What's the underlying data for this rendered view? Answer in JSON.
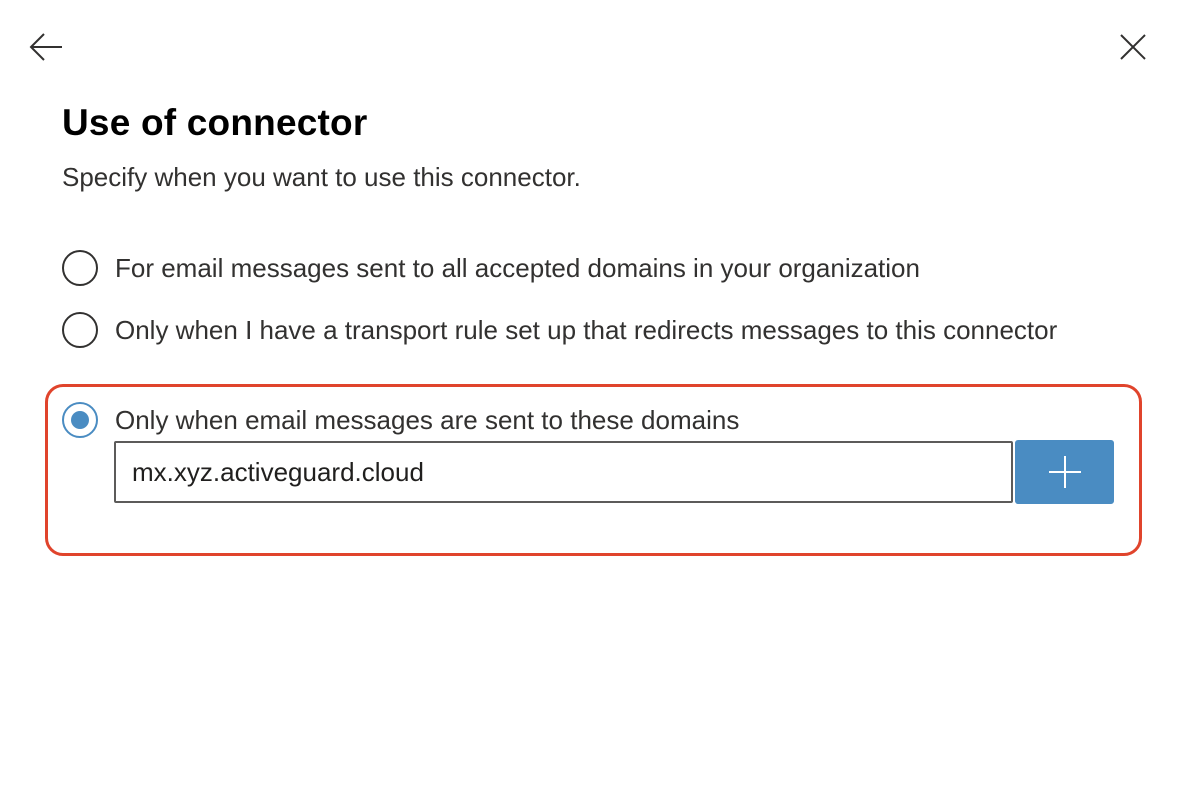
{
  "header": {
    "back_icon": "arrow-left-icon",
    "close_icon": "close-icon"
  },
  "panel": {
    "title": "Use of connector",
    "subtitle": "Specify when you want to use this connector."
  },
  "options": [
    {
      "label": "For email messages sent to all accepted domains in your organization",
      "selected": false
    },
    {
      "label": "Only when I have a transport rule set up that redirects messages to this connector",
      "selected": false
    },
    {
      "label": "Only when email messages are sent to these domains",
      "selected": true
    }
  ],
  "domain_input": {
    "value": "mx.xyz.activeguard.cloud"
  },
  "add_button": {
    "icon": "plus-icon"
  },
  "colors": {
    "accent": "#4a8cc2",
    "highlight_border": "#e0442c"
  }
}
